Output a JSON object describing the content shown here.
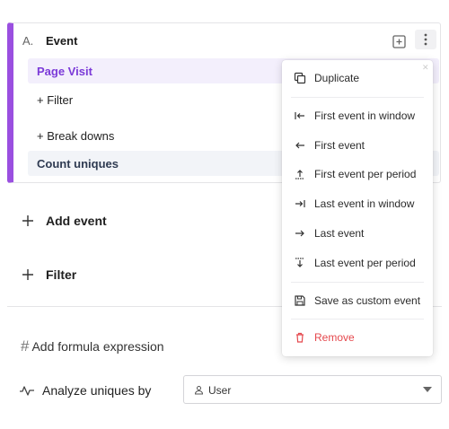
{
  "event_card": {
    "letter": "A.",
    "title": "Event",
    "event_name": "Page Visit",
    "filter_label": "+ Filter",
    "breakdowns_label": "+ Break downs",
    "metric_label": "Count uniques",
    "accent_color": "#9a4fe0"
  },
  "actions": {
    "add_event": "Add event",
    "filter": "Filter",
    "formula": "Add formula expression",
    "analyze_label": "Analyze uniques by"
  },
  "analyze_select": {
    "value": "User",
    "icon": "user-icon"
  },
  "menu": {
    "items": [
      {
        "label": "Duplicate",
        "icon": "duplicate-icon"
      },
      {
        "label": "First event in window",
        "icon": "arrow-left-bar-icon"
      },
      {
        "label": "First event",
        "icon": "arrow-left-icon"
      },
      {
        "label": "First event per period",
        "icon": "arrow-up-bar-icon"
      },
      {
        "label": "Last event in window",
        "icon": "arrow-right-bar-icon"
      },
      {
        "label": "Last event",
        "icon": "arrow-right-icon"
      },
      {
        "label": "Last event per period",
        "icon": "arrow-down-bar-icon"
      },
      {
        "label": "Save as custom event",
        "icon": "save-icon"
      },
      {
        "label": "Remove",
        "icon": "trash-icon",
        "color": "#e5484d"
      }
    ]
  }
}
